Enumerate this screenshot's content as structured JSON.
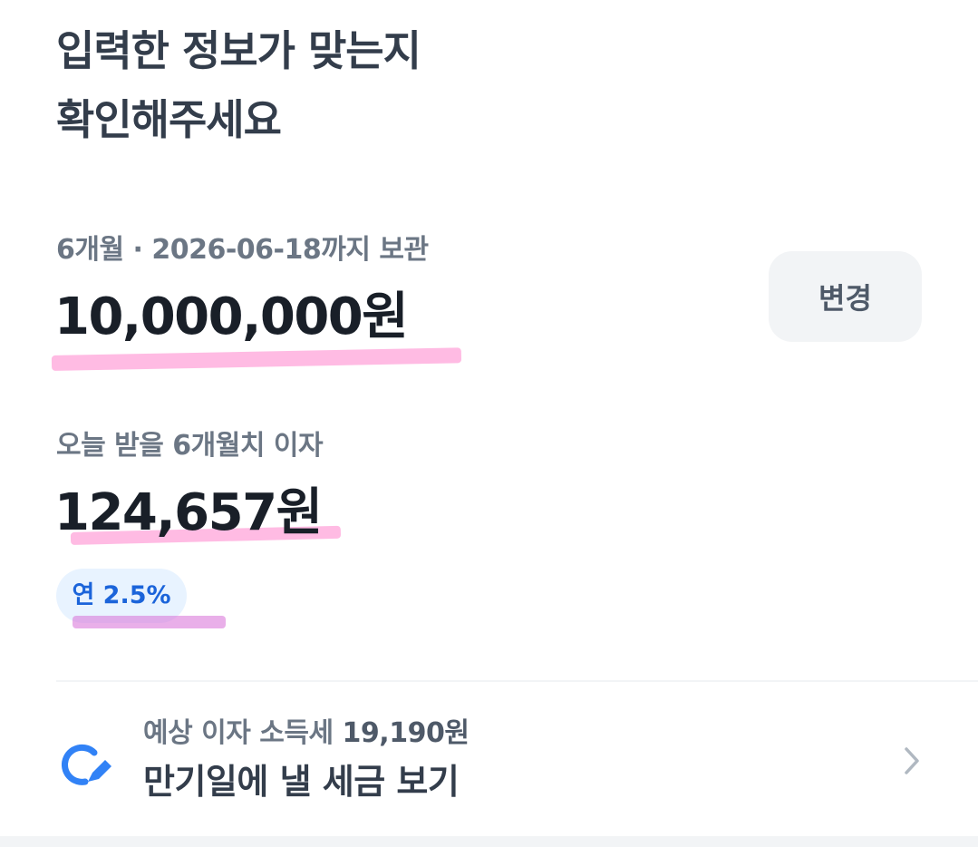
{
  "page": {
    "title_line1": "입력한 정보가 맞는지",
    "title_line2": "확인해주세요"
  },
  "deposit": {
    "meta": "6개월 · 2026-06-18까지 보관",
    "amount": "10,000,000원",
    "change_button_label": "변경"
  },
  "interest": {
    "label": "오늘 받을 6개월치 이자",
    "amount": "124,657원",
    "rate_badge": "연 2.5%"
  },
  "tax": {
    "subtitle_prefix": "예상 이자 소득세",
    "subtitle_amount": "19,190원",
    "title": "만기일에 낼 세금 보기",
    "icon": "pencil-circle-icon",
    "chevron": "chevron-right-icon"
  },
  "colors": {
    "accent_blue": "#3182f6",
    "badge_text": "#1b64da",
    "badge_bg": "#e8f3ff",
    "highlight_pink": "#ff78c8",
    "button_bg": "#f2f4f6"
  }
}
